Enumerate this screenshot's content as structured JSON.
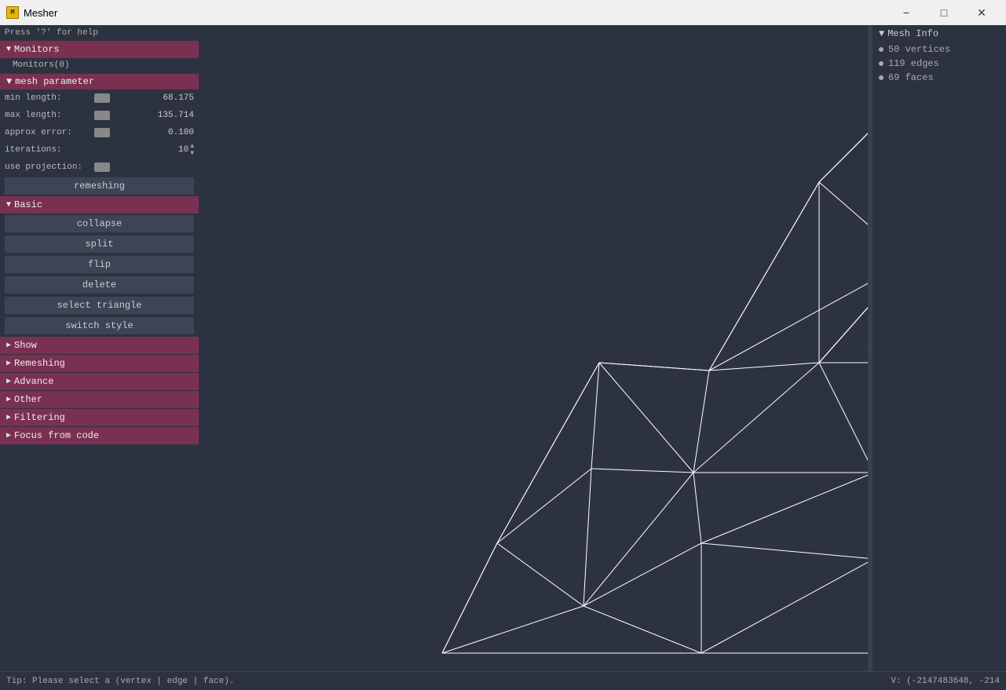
{
  "titlebar": {
    "app_name": "Mesher",
    "app_icon_text": "M",
    "minimize_label": "−",
    "maximize_label": "□",
    "close_label": "✕"
  },
  "sidebar": {
    "tip": "Press '?' for help",
    "monitors_section": {
      "label": "Monitors",
      "arrow": "▼",
      "sub_item": "Monitors(0)"
    },
    "mesh_param_section": {
      "label": "mesh parameter",
      "arrow": "▼",
      "params": [
        {
          "label": "min length:",
          "value": "68.175"
        },
        {
          "label": "max length:",
          "value": "135.714"
        },
        {
          "label": "approx error:",
          "value": "0.100"
        },
        {
          "label": "iterations:",
          "value": "10"
        },
        {
          "label": "use projection:",
          "value": ""
        }
      ],
      "remesh_btn": "remeshing"
    },
    "basic_section": {
      "label": "Basic",
      "arrow": "▼",
      "buttons": [
        "collapse",
        "split",
        "flip",
        "delete",
        "select triangle",
        "switch style"
      ]
    },
    "collapsed_sections": [
      {
        "label": "Show",
        "arrow": "▶"
      },
      {
        "label": "Remeshing",
        "arrow": "▶"
      },
      {
        "label": "Advance",
        "arrow": "▶"
      },
      {
        "label": "Other",
        "arrow": "▶"
      },
      {
        "label": "Filtering",
        "arrow": "▶"
      },
      {
        "label": "Focus from code",
        "arrow": "▶"
      }
    ]
  },
  "mesh_info": {
    "header": "Mesh Info",
    "arrow": "▼",
    "items": [
      {
        "label": "50 vertices"
      },
      {
        "label": "119 edges"
      },
      {
        "label": "69 faces"
      }
    ]
  },
  "statusbar": {
    "tip": "Tip: Please select a (vertex | edge | face).",
    "coords": "V: (-2147483648, -214"
  },
  "colors": {
    "sidebar_bg": "#2d3240",
    "section_header_bg": "#7a3050",
    "mesh_line": "#ffffff",
    "mesh_bg": "#2d3240"
  }
}
